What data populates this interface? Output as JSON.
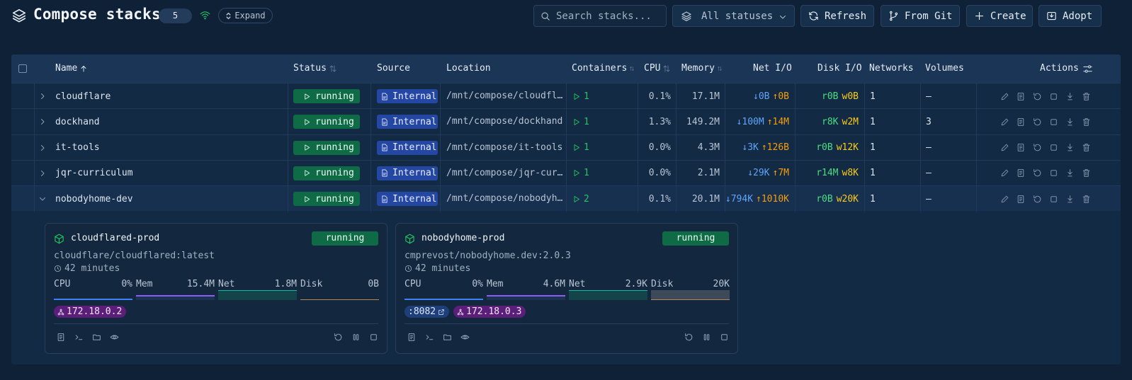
{
  "header": {
    "title": "Compose stacks",
    "count": "5",
    "expand_label": "Expand",
    "search_placeholder": "Search stacks...",
    "status_filter": "All statuses",
    "buttons": {
      "refresh": "Refresh",
      "from_git": "From Git",
      "create": "Create",
      "adopt": "Adopt"
    }
  },
  "table": {
    "columns": {
      "name": "Name",
      "status": "Status",
      "source": "Source",
      "location": "Location",
      "containers": "Containers",
      "cpu": "CPU",
      "memory": "Memory",
      "net_io": "Net I/O",
      "disk_io": "Disk I/O",
      "networks": "Networks",
      "volumes": "Volumes",
      "actions": "Actions"
    },
    "rows": [
      {
        "name": "cloudflare",
        "status": "running",
        "source": "Internal",
        "location": "/mnt/compose/cloudflare",
        "containers": "1",
        "cpu": "0.1%",
        "memory": "17.1M",
        "net_down": "↓0B",
        "net_up": "↑0B",
        "disk_r": "r0B",
        "disk_w": "w0B",
        "networks": "1",
        "volumes": "–"
      },
      {
        "name": "dockhand",
        "status": "running",
        "source": "Internal",
        "location": "/mnt/compose/dockhand",
        "containers": "1",
        "cpu": "1.3%",
        "memory": "149.2M",
        "net_down": "↓100M",
        "net_up": "↑14M",
        "disk_r": "r8K",
        "disk_w": "w2M",
        "networks": "1",
        "volumes": "3"
      },
      {
        "name": "it-tools",
        "status": "running",
        "source": "Internal",
        "location": "/mnt/compose/it-tools",
        "containers": "1",
        "cpu": "0.0%",
        "memory": "4.3M",
        "net_down": "↓3K",
        "net_up": "↑126B",
        "disk_r": "r0B",
        "disk_w": "w12K",
        "networks": "1",
        "volumes": "–"
      },
      {
        "name": "jqr-curriculum",
        "status": "running",
        "source": "Internal",
        "location": "/mnt/compose/jqr-curriculum",
        "containers": "1",
        "cpu": "0.0%",
        "memory": "2.1M",
        "net_down": "↓29K",
        "net_up": "↑7M",
        "disk_r": "r14M",
        "disk_w": "w8K",
        "networks": "1",
        "volumes": "–"
      },
      {
        "name": "nobodyhome-dev",
        "status": "running",
        "source": "Internal",
        "location": "/mnt/compose/nobodyhome-dev",
        "containers": "2",
        "cpu": "0.1%",
        "memory": "20.1M",
        "net_down": "↓794K",
        "net_up": "↑1010K",
        "disk_r": "r0B",
        "disk_w": "w20K",
        "networks": "1",
        "volumes": "–"
      }
    ]
  },
  "containers": [
    {
      "name": "cloudflared-prod",
      "status": "running",
      "image": "cloudflare/cloudflared:latest",
      "uptime": "42 minutes",
      "metrics": {
        "cpu_label": "CPU",
        "cpu": "0%",
        "mem_label": "Mem",
        "mem": "15.4M",
        "net_label": "Net",
        "net": "1.8M",
        "disk_label": "Disk",
        "disk": "0B"
      },
      "chips": {
        "ip": "172.18.0.2"
      }
    },
    {
      "name": "nobodyhome-prod",
      "status": "running",
      "image": "cmprevost/nobodyhome.dev:2.0.3",
      "uptime": "42 minutes",
      "metrics": {
        "cpu_label": "CPU",
        "cpu": "0%",
        "mem_label": "Mem",
        "mem": "4.6M",
        "net_label": "Net",
        "net": "2.9K",
        "disk_label": "Disk",
        "disk": "20K"
      },
      "chips": {
        "port": ":8082",
        "ip": "172.18.0.3"
      }
    }
  ],
  "colors": {
    "background": "#0f2137",
    "running": "#0f6b45",
    "internal": "#2547a4",
    "cpu": "#3b82f6",
    "mem": "#8b5cf6",
    "net": "#14b8a6",
    "disk": "#f59e0b"
  }
}
